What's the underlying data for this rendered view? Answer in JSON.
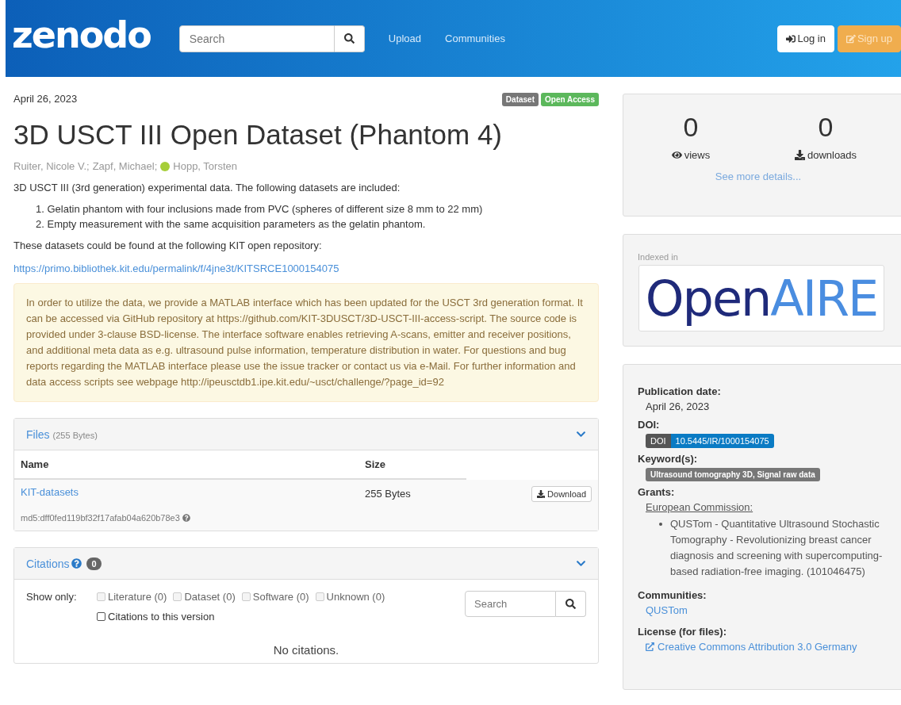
{
  "header": {
    "logo": "zenodo",
    "search": {
      "placeholder": "Search"
    },
    "nav": [
      "Upload",
      "Communities"
    ],
    "login": "Log in",
    "signup": "Sign up"
  },
  "record": {
    "date": "April 26, 2023",
    "badges": [
      {
        "label": "Dataset",
        "color": "#777777"
      },
      {
        "label": "Open Access",
        "color": "#5cb85c"
      }
    ],
    "title": "3D USCT III Open Dataset (Phantom 4)",
    "authors": [
      {
        "name": "Ruiter, Nicole V.;",
        "orcid": false
      },
      {
        "name": "Zapf, Michael;",
        "orcid": false
      },
      {
        "name": "Hopp, Torsten",
        "orcid": true
      }
    ],
    "intro": "3D USCT III (3rd generation) experimental data. The following datasets are included:",
    "list": [
      {
        "num": "1.",
        "text": "Gelatin phantom with four inclusions made from PVC (spheres of different size 8 mm to 22 mm)"
      },
      {
        "num": "2.",
        "text": "Empty measurement with the same acquisition parameters as the gelatin phantom."
      }
    ],
    "repo_text": "These datasets could be found at the following KIT open repository:",
    "repo_link": "https://primo.bibliothek.kit.edu/permalink/f/4jne3t/KITSRCE1000154075",
    "notice": "In order to utilize the data, we provide a MATLAB interface which has been updated for the USCT 3rd generation format. It can be accessed via GitHub repository at https://github.com/KIT-3DUSCT/3D-USCT-III-access-script. The source code is provided under 3-clause BSD-license. The interface software enables retrieving A-scans, emitter and receiver positions, and additional meta data as e.g. ultrasound pulse information, temperature distribution in water. For questions and bug reports regarding the MATLAB interface please use the issue tracker or contact us via e-Mail. For further information and data access scripts see webpage http://ipeusctdb1.ipe.kit.edu/~usct/challenge/?page_id=92"
  },
  "files": {
    "title": "Files",
    "size": "(255 Bytes)",
    "columns": [
      "Name",
      "Size"
    ],
    "rows": [
      {
        "name": "KIT-datasets",
        "size": "255 Bytes",
        "button": "Download",
        "checksum": "md5:dff0fed119bf32f17afab04a620b78e3"
      }
    ]
  },
  "citations": {
    "title": "Citations",
    "count": "0",
    "show_only": "Show only:",
    "filters": [
      {
        "label": "Literature (0)",
        "checked": false,
        "disabled": true
      },
      {
        "label": "Dataset (0)",
        "checked": false,
        "disabled": true
      },
      {
        "label": "Software (0)",
        "checked": false,
        "disabled": true
      },
      {
        "label": "Unknown (0)",
        "checked": false,
        "disabled": true
      },
      {
        "label": "Citations to this version",
        "checked": false,
        "disabled": false
      }
    ],
    "search": {
      "placeholder": "Search"
    },
    "empty": "No citations."
  },
  "stats": [
    {
      "value": "0",
      "label": "views",
      "kind": "views"
    },
    {
      "value": "0",
      "label": "downloads",
      "kind": "downloads"
    }
  ],
  "stats_link": "See more details...",
  "indexed": {
    "label": "Indexed in",
    "logo_a": "Open",
    "logo_b": "AIRE"
  },
  "meta": {
    "pub_label": "Publication date:",
    "pub_date": "April 26, 2023",
    "doi_label": "DOI:",
    "doi_tag": "DOI",
    "doi": "10.5445/IR/1000154075",
    "kw_label": "Keyword(s):",
    "keywords": "Ultrasound tomography 3D, Signal raw data",
    "grants_label": "Grants:",
    "funder": "European Commission:",
    "grants": [
      "QUSTom - Quantitative Ultrasound Stochastic Tomography - Revolutionizing breast cancer diagnosis and screening with supercomputing-based radiation-free imaging. (101046475)"
    ],
    "comm_label": "Communities:",
    "community": "QUSTom",
    "lic_label": "License (for files):",
    "license": "Creative Commons Attribution 3.0 Germany"
  }
}
